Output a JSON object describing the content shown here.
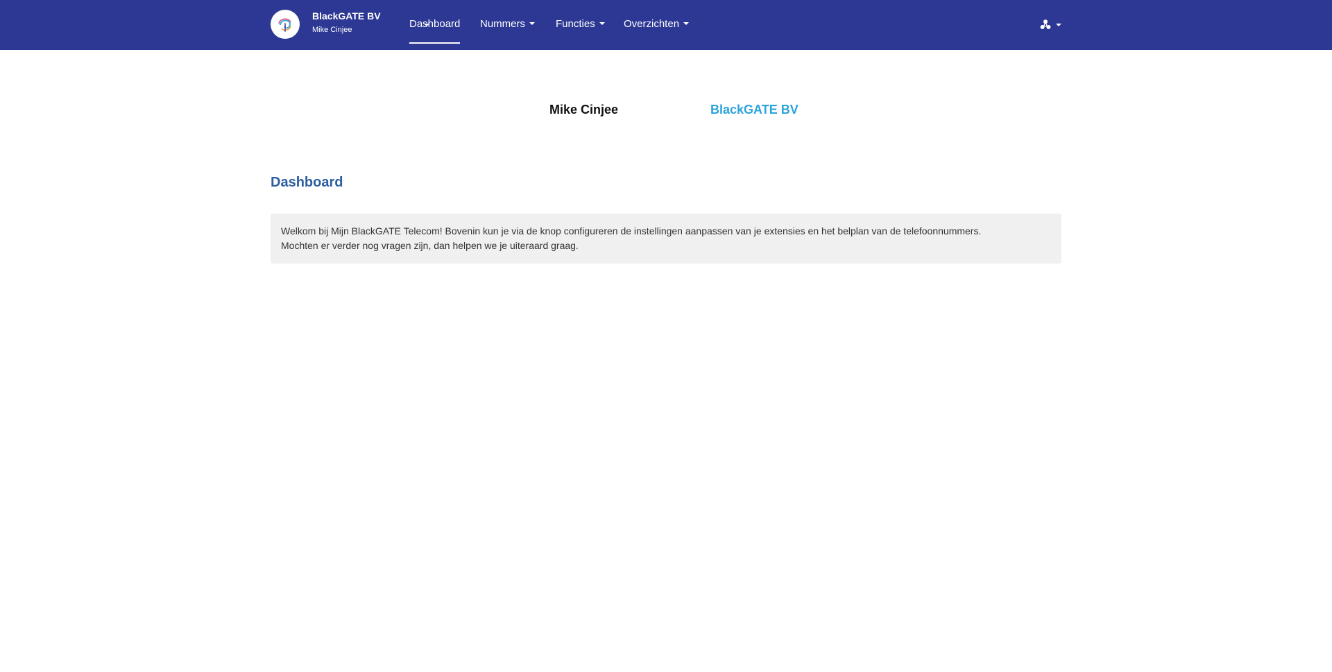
{
  "header": {
    "account_name": "BlackGATE BV",
    "account_user": "Mike Cinjee",
    "nav": [
      {
        "label": "Dashboard",
        "active": true
      },
      {
        "label": "Nummers",
        "active": false
      },
      {
        "label": "Functies",
        "active": false
      },
      {
        "label": "Overzichten",
        "active": false
      }
    ],
    "settings_icon": "settings-cog-icon",
    "background_color": "#2c3893"
  },
  "tabs": {
    "user": "Mike Cinjee",
    "company": "BlackGATE BV",
    "company_color": "#2ba4dd"
  },
  "main": {
    "title": "Dashboard",
    "welcome_line1": "Welkom bij Mijn BlackGATE Telecom! Bovenin kun je via de knop configureren de instellingen aanpassen van je extensies en het belplan van de telefoonnummers.",
    "welcome_line2": "Mochten er verder nog vragen zijn, dan helpen we je uiteraard graag."
  }
}
